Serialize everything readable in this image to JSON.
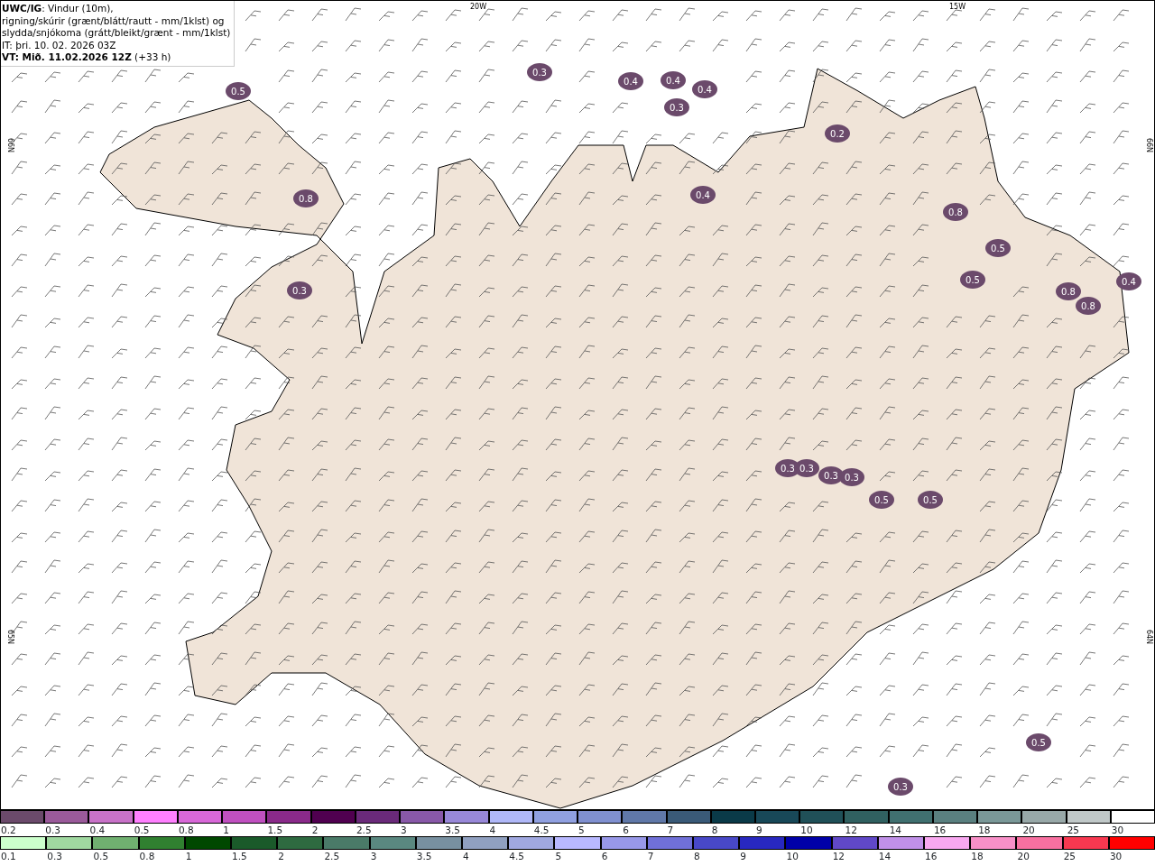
{
  "title_box": {
    "lines": [
      "**UWC/IG**: Vindur (10m),",
      "rigning/skúrir (grænt/blátt/rautt - mm/1klst) og",
      "slydda/snjókoma (grátt/bleikt/grænt - mm/1klst)",
      "IT: þri. 10. 02. 2026 03Z",
      "**VT: Mið. 11.02.2026 12Z** (+33 h)"
    ]
  },
  "map": {
    "top_labels": [
      "20W",
      "15W"
    ],
    "left_labels": [
      "66N",
      "65N"
    ],
    "right_labels": [
      "66N",
      "64N"
    ],
    "precip_labels": [
      "0.5",
      "0.3",
      "0.4",
      "0.4",
      "0.4",
      "0.3",
      "0.8",
      "0.3",
      "0.2",
      "0.4",
      "0.8",
      "0.5",
      "0.5",
      "0.8",
      "0.8",
      "0.4",
      "0.3",
      "0.3",
      "0.3",
      "0.3",
      "0.5",
      "0.5",
      "0.5",
      "0.3"
    ]
  },
  "legend_rows": [
    {
      "swatches": [
        {
          "label": "0.2",
          "color": "#6b4a6b"
        },
        {
          "label": "0.3",
          "color": "#9a5a9a"
        },
        {
          "label": "0.4",
          "color": "#c872c8"
        },
        {
          "label": "0.5",
          "color": "#ff80ff"
        },
        {
          "label": "0.8",
          "color": "#d868d8"
        },
        {
          "label": "1",
          "color": "#c050c0"
        },
        {
          "label": "1.5",
          "color": "#8a2a8a"
        },
        {
          "label": "2",
          "color": "#500050"
        },
        {
          "label": "2.5",
          "color": "#6a2a7a"
        },
        {
          "label": "3",
          "color": "#8858a8"
        },
        {
          "label": "3.5",
          "color": "#9888d8"
        },
        {
          "label": "4",
          "color": "#b0b8f8"
        },
        {
          "label": "4.5",
          "color": "#90a0e0"
        },
        {
          "label": "5",
          "color": "#8090d0"
        },
        {
          "label": "6",
          "color": "#6078a8"
        },
        {
          "label": "7",
          "color": "#3a5a78"
        },
        {
          "label": "8",
          "color": "#0a3a48"
        },
        {
          "label": "9",
          "color": "#184858"
        },
        {
          "label": "10",
          "color": "#205058"
        },
        {
          "label": "12",
          "color": "#306060"
        },
        {
          "label": "14",
          "color": "#407070"
        },
        {
          "label": "16",
          "color": "#5a8080"
        },
        {
          "label": "18",
          "color": "#7a9898"
        },
        {
          "label": "20",
          "color": "#98a8a8"
        },
        {
          "label": "25",
          "color": "#c0c8c8"
        },
        {
          "label": "30",
          "color": "#ffffff"
        }
      ]
    },
    {
      "swatches": [
        {
          "label": "0.1",
          "color": "#ccffcc"
        },
        {
          "label": "0.3",
          "color": "#a0d8a0"
        },
        {
          "label": "0.5",
          "color": "#70b070"
        },
        {
          "label": "0.8",
          "color": "#308030"
        },
        {
          "label": "1",
          "color": "#004800"
        },
        {
          "label": "1.5",
          "color": "#1a5a2a"
        },
        {
          "label": "2",
          "color": "#2e6a40"
        },
        {
          "label": "2.5",
          "color": "#4a7a68"
        },
        {
          "label": "3",
          "color": "#5a8880"
        },
        {
          "label": "3.5",
          "color": "#7890a0"
        },
        {
          "label": "4",
          "color": "#90a0c0"
        },
        {
          "label": "4.5",
          "color": "#a0a8e0"
        },
        {
          "label": "5",
          "color": "#b8b8ff"
        },
        {
          "label": "6",
          "color": "#9898e8"
        },
        {
          "label": "7",
          "color": "#7070d8"
        },
        {
          "label": "8",
          "color": "#4848c8"
        },
        {
          "label": "9",
          "color": "#2828c0"
        },
        {
          "label": "10",
          "color": "#0000a8"
        },
        {
          "label": "12",
          "color": "#6048c8"
        },
        {
          "label": "14",
          "color": "#c090e8"
        },
        {
          "label": "16",
          "color": "#f8a8f0"
        },
        {
          "label": "18",
          "color": "#f890c8"
        },
        {
          "label": "20",
          "color": "#f870a0"
        },
        {
          "label": "25",
          "color": "#f83850"
        },
        {
          "label": "30",
          "color": "#ff0000"
        }
      ]
    }
  ]
}
